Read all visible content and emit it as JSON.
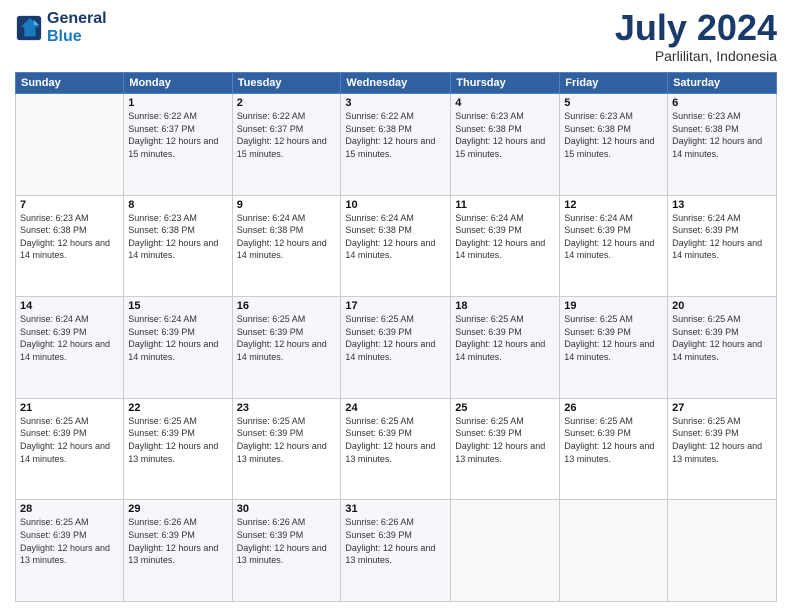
{
  "header": {
    "logo_line1": "General",
    "logo_line2": "Blue",
    "main_title": "July 2024",
    "subtitle": "Parlilitan, Indonesia"
  },
  "days_of_week": [
    "Sunday",
    "Monday",
    "Tuesday",
    "Wednesday",
    "Thursday",
    "Friday",
    "Saturday"
  ],
  "weeks": [
    [
      {
        "day": "",
        "sunrise": "",
        "sunset": "",
        "daylight": ""
      },
      {
        "day": "1",
        "sunrise": "Sunrise: 6:22 AM",
        "sunset": "Sunset: 6:37 PM",
        "daylight": "Daylight: 12 hours and 15 minutes."
      },
      {
        "day": "2",
        "sunrise": "Sunrise: 6:22 AM",
        "sunset": "Sunset: 6:37 PM",
        "daylight": "Daylight: 12 hours and 15 minutes."
      },
      {
        "day": "3",
        "sunrise": "Sunrise: 6:22 AM",
        "sunset": "Sunset: 6:38 PM",
        "daylight": "Daylight: 12 hours and 15 minutes."
      },
      {
        "day": "4",
        "sunrise": "Sunrise: 6:23 AM",
        "sunset": "Sunset: 6:38 PM",
        "daylight": "Daylight: 12 hours and 15 minutes."
      },
      {
        "day": "5",
        "sunrise": "Sunrise: 6:23 AM",
        "sunset": "Sunset: 6:38 PM",
        "daylight": "Daylight: 12 hours and 15 minutes."
      },
      {
        "day": "6",
        "sunrise": "Sunrise: 6:23 AM",
        "sunset": "Sunset: 6:38 PM",
        "daylight": "Daylight: 12 hours and 14 minutes."
      }
    ],
    [
      {
        "day": "7",
        "sunrise": "Sunrise: 6:23 AM",
        "sunset": "Sunset: 6:38 PM",
        "daylight": "Daylight: 12 hours and 14 minutes."
      },
      {
        "day": "8",
        "sunrise": "Sunrise: 6:23 AM",
        "sunset": "Sunset: 6:38 PM",
        "daylight": "Daylight: 12 hours and 14 minutes."
      },
      {
        "day": "9",
        "sunrise": "Sunrise: 6:24 AM",
        "sunset": "Sunset: 6:38 PM",
        "daylight": "Daylight: 12 hours and 14 minutes."
      },
      {
        "day": "10",
        "sunrise": "Sunrise: 6:24 AM",
        "sunset": "Sunset: 6:38 PM",
        "daylight": "Daylight: 12 hours and 14 minutes."
      },
      {
        "day": "11",
        "sunrise": "Sunrise: 6:24 AM",
        "sunset": "Sunset: 6:39 PM",
        "daylight": "Daylight: 12 hours and 14 minutes."
      },
      {
        "day": "12",
        "sunrise": "Sunrise: 6:24 AM",
        "sunset": "Sunset: 6:39 PM",
        "daylight": "Daylight: 12 hours and 14 minutes."
      },
      {
        "day": "13",
        "sunrise": "Sunrise: 6:24 AM",
        "sunset": "Sunset: 6:39 PM",
        "daylight": "Daylight: 12 hours and 14 minutes."
      }
    ],
    [
      {
        "day": "14",
        "sunrise": "Sunrise: 6:24 AM",
        "sunset": "Sunset: 6:39 PM",
        "daylight": "Daylight: 12 hours and 14 minutes."
      },
      {
        "day": "15",
        "sunrise": "Sunrise: 6:24 AM",
        "sunset": "Sunset: 6:39 PM",
        "daylight": "Daylight: 12 hours and 14 minutes."
      },
      {
        "day": "16",
        "sunrise": "Sunrise: 6:25 AM",
        "sunset": "Sunset: 6:39 PM",
        "daylight": "Daylight: 12 hours and 14 minutes."
      },
      {
        "day": "17",
        "sunrise": "Sunrise: 6:25 AM",
        "sunset": "Sunset: 6:39 PM",
        "daylight": "Daylight: 12 hours and 14 minutes."
      },
      {
        "day": "18",
        "sunrise": "Sunrise: 6:25 AM",
        "sunset": "Sunset: 6:39 PM",
        "daylight": "Daylight: 12 hours and 14 minutes."
      },
      {
        "day": "19",
        "sunrise": "Sunrise: 6:25 AM",
        "sunset": "Sunset: 6:39 PM",
        "daylight": "Daylight: 12 hours and 14 minutes."
      },
      {
        "day": "20",
        "sunrise": "Sunrise: 6:25 AM",
        "sunset": "Sunset: 6:39 PM",
        "daylight": "Daylight: 12 hours and 14 minutes."
      }
    ],
    [
      {
        "day": "21",
        "sunrise": "Sunrise: 6:25 AM",
        "sunset": "Sunset: 6:39 PM",
        "daylight": "Daylight: 12 hours and 14 minutes."
      },
      {
        "day": "22",
        "sunrise": "Sunrise: 6:25 AM",
        "sunset": "Sunset: 6:39 PM",
        "daylight": "Daylight: 12 hours and 13 minutes."
      },
      {
        "day": "23",
        "sunrise": "Sunrise: 6:25 AM",
        "sunset": "Sunset: 6:39 PM",
        "daylight": "Daylight: 12 hours and 13 minutes."
      },
      {
        "day": "24",
        "sunrise": "Sunrise: 6:25 AM",
        "sunset": "Sunset: 6:39 PM",
        "daylight": "Daylight: 12 hours and 13 minutes."
      },
      {
        "day": "25",
        "sunrise": "Sunrise: 6:25 AM",
        "sunset": "Sunset: 6:39 PM",
        "daylight": "Daylight: 12 hours and 13 minutes."
      },
      {
        "day": "26",
        "sunrise": "Sunrise: 6:25 AM",
        "sunset": "Sunset: 6:39 PM",
        "daylight": "Daylight: 12 hours and 13 minutes."
      },
      {
        "day": "27",
        "sunrise": "Sunrise: 6:25 AM",
        "sunset": "Sunset: 6:39 PM",
        "daylight": "Daylight: 12 hours and 13 minutes."
      }
    ],
    [
      {
        "day": "28",
        "sunrise": "Sunrise: 6:25 AM",
        "sunset": "Sunset: 6:39 PM",
        "daylight": "Daylight: 12 hours and 13 minutes."
      },
      {
        "day": "29",
        "sunrise": "Sunrise: 6:26 AM",
        "sunset": "Sunset: 6:39 PM",
        "daylight": "Daylight: 12 hours and 13 minutes."
      },
      {
        "day": "30",
        "sunrise": "Sunrise: 6:26 AM",
        "sunset": "Sunset: 6:39 PM",
        "daylight": "Daylight: 12 hours and 13 minutes."
      },
      {
        "day": "31",
        "sunrise": "Sunrise: 6:26 AM",
        "sunset": "Sunset: 6:39 PM",
        "daylight": "Daylight: 12 hours and 13 minutes."
      },
      {
        "day": "",
        "sunrise": "",
        "sunset": "",
        "daylight": ""
      },
      {
        "day": "",
        "sunrise": "",
        "sunset": "",
        "daylight": ""
      },
      {
        "day": "",
        "sunrise": "",
        "sunset": "",
        "daylight": ""
      }
    ]
  ]
}
